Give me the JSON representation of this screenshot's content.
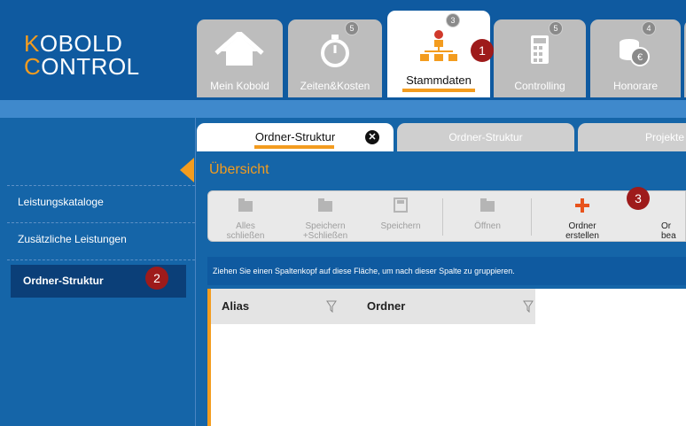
{
  "logo": {
    "line1_accent": "K",
    "line1_rest": "OBOLD",
    "line2_accent": "C",
    "line2_rest": "ONTROL"
  },
  "top_tabs": [
    {
      "label": "Mein Kobold",
      "icon": "home-icon",
      "badge": ""
    },
    {
      "label": "Zeiten&Kosten",
      "icon": "stopwatch-icon",
      "badge": "5"
    },
    {
      "label": "Stammdaten",
      "icon": "hierarchy-icon",
      "badge": "3"
    },
    {
      "label": "Controlling",
      "icon": "calculator-icon",
      "badge": "5"
    },
    {
      "label": "Honorare",
      "icon": "coins-icon",
      "badge": "4"
    }
  ],
  "sidebar": {
    "items": [
      {
        "label": "Leistungskataloge"
      },
      {
        "label": "Zusätzliche Leistungen"
      },
      {
        "label": "Ordner-Struktur"
      }
    ]
  },
  "subtabs": [
    {
      "label": "Ordner-Struktur"
    },
    {
      "label": "Ordner-Struktur"
    },
    {
      "label": "Projekte"
    }
  ],
  "main": {
    "title": "Übersicht"
  },
  "toolbar": {
    "buttons": [
      {
        "label1": "Alles",
        "label2": "schließen",
        "icon": "folder-close-icon"
      },
      {
        "label1": "Speichern",
        "label2": "+Schließen",
        "icon": "folder-save-icon"
      },
      {
        "label1": "Speichern",
        "label2": "",
        "icon": "save-icon"
      },
      {
        "label1": "Öffnen",
        "label2": "",
        "icon": "folder-open-icon"
      },
      {
        "label1": "Ordner",
        "label2": "erstellen",
        "icon": "plus-icon"
      },
      {
        "label1": "Or",
        "label2": "bea",
        "icon": "edit-icon"
      }
    ]
  },
  "group_bar": {
    "text": "Ziehen Sie einen Spaltenkopf auf diese Fläche, um nach dieser Spalte zu gruppieren."
  },
  "grid": {
    "columns": [
      "Alias",
      "Ordner"
    ]
  },
  "markers": [
    "1",
    "2",
    "3"
  ],
  "colors": {
    "brand_blue": "#0f5aa0",
    "accent_orange": "#f39c1f",
    "marker_red": "#9e1b1b"
  }
}
